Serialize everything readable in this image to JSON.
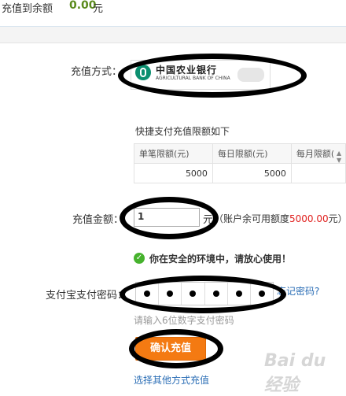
{
  "header": {
    "label": "充值到余额",
    "amount": "0.00",
    "unit": "元"
  },
  "method": {
    "label": "充值方式：",
    "bank_name_cn": "中国农业银行",
    "bank_name_en": "AGRICULTURAL BANK OF CHINA",
    "brand_color": "#0b8f6f"
  },
  "limits": {
    "title": "快捷支付充值限额如下",
    "columns": [
      "单笔限额(元)",
      "每日限额(元)",
      "每月限额("
    ],
    "rows": [
      [
        "5000",
        "5000",
        ""
      ]
    ]
  },
  "amount": {
    "label": "充值金额：",
    "value": "1",
    "unit": "元",
    "available_prefix": "（账户余可用额度",
    "available_value": "5000.00",
    "available_suffix": "元）"
  },
  "safety": {
    "text": "你在安全的环境中，请放心使用！"
  },
  "password": {
    "label": "支付宝支付密码：",
    "forgot": "忘记密码?",
    "hint": "请输入6位数字支付密码"
  },
  "actions": {
    "confirm": "确认充值",
    "other": "选择其他方式充值"
  },
  "watermark": {
    "text": "Bai du 经验"
  }
}
